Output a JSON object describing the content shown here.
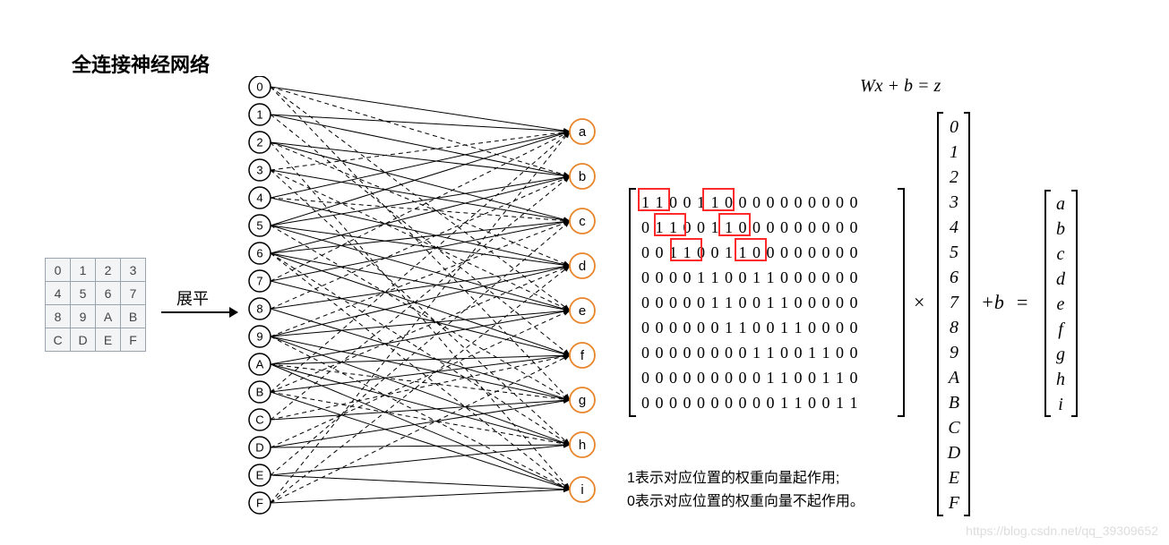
{
  "title": "全连接神经网络",
  "grid": [
    [
      "0",
      "1",
      "2",
      "3"
    ],
    [
      "4",
      "5",
      "6",
      "7"
    ],
    [
      "8",
      "9",
      "A",
      "B"
    ],
    [
      "C",
      "D",
      "E",
      "F"
    ]
  ],
  "flatten_label": "展平",
  "input_nodes": [
    "0",
    "1",
    "2",
    "3",
    "4",
    "5",
    "6",
    "7",
    "8",
    "9",
    "A",
    "B",
    "C",
    "D",
    "E",
    "F"
  ],
  "output_nodes": [
    "a",
    "b",
    "c",
    "d",
    "e",
    "f",
    "g",
    "h",
    "i"
  ],
  "equation": "Wx + b = z",
  "W_rows": [
    "1 1 0 0 1 1 0 0 0 0 0 0 0 0 0 0",
    "0 1 1 0 0 1 1 0 0 0 0 0 0 0 0 0",
    "0 0 1 1 0 0 1 1 0 0 0 0 0 0 0 0",
    "0 0 0 0 1 1 0 0 1 1 0 0 0 0 0 0",
    "0 0 0 0 0 1 1 0 0 1 1 0 0 0 0 0",
    "0 0 0 0 0 0 1 1 0 0 1 1 0 0 0 0",
    "0 0 0 0 0 0 0 0 1 1 0 0 1 1 0 0",
    "0 0 0 0 0 0 0 0 0 1 1 0 0 1 1 0",
    "0 0 0 0 0 0 0 0 0 0 1 1 0 0 1 1"
  ],
  "x_vec": [
    "0",
    "1",
    "2",
    "3",
    "4",
    "5",
    "6",
    "7",
    "8",
    "9",
    "A",
    "B",
    "C",
    "D",
    "E",
    "F"
  ],
  "z_vec": [
    "a",
    "b",
    "c",
    "d",
    "e",
    "f",
    "g",
    "h",
    "i"
  ],
  "times": "×",
  "plus_b": "+b",
  "equals": "=",
  "explain_line1": "1表示对应位置的权重向量起作用;",
  "explain_line2": "0表示对应位置的权重向量不起作用。",
  "watermark": "https://blog.csdn.net/qq_39309652",
  "edges_solid": [
    [
      0,
      0
    ],
    [
      1,
      0
    ],
    [
      4,
      0
    ],
    [
      5,
      0
    ],
    [
      1,
      1
    ],
    [
      2,
      1
    ],
    [
      5,
      1
    ],
    [
      6,
      1
    ],
    [
      2,
      2
    ],
    [
      3,
      2
    ],
    [
      6,
      2
    ],
    [
      7,
      2
    ],
    [
      4,
      3
    ],
    [
      5,
      3
    ],
    [
      8,
      3
    ],
    [
      9,
      3
    ],
    [
      5,
      4
    ],
    [
      6,
      4
    ],
    [
      9,
      4
    ],
    [
      10,
      4
    ],
    [
      6,
      5
    ],
    [
      7,
      5
    ],
    [
      10,
      5
    ],
    [
      11,
      5
    ],
    [
      8,
      6
    ],
    [
      9,
      6
    ],
    [
      12,
      6
    ],
    [
      13,
      6
    ],
    [
      9,
      7
    ],
    [
      10,
      7
    ],
    [
      13,
      7
    ],
    [
      14,
      7
    ],
    [
      10,
      8
    ],
    [
      11,
      8
    ],
    [
      14,
      8
    ],
    [
      15,
      8
    ]
  ],
  "edges_dash": [
    [
      3,
      0
    ],
    [
      7,
      0
    ],
    [
      11,
      0
    ],
    [
      15,
      0
    ],
    [
      0,
      1
    ],
    [
      8,
      1
    ],
    [
      12,
      1
    ],
    [
      4,
      2
    ],
    [
      9,
      2
    ],
    [
      14,
      2
    ],
    [
      2,
      3
    ],
    [
      11,
      3
    ],
    [
      15,
      3
    ],
    [
      0,
      4
    ],
    [
      3,
      4
    ],
    [
      13,
      4
    ],
    [
      1,
      5
    ],
    [
      12,
      5
    ],
    [
      15,
      5
    ],
    [
      0,
      6
    ],
    [
      5,
      6
    ],
    [
      10,
      6
    ],
    [
      3,
      7
    ],
    [
      6,
      7
    ],
    [
      11,
      7
    ],
    [
      2,
      8
    ],
    [
      6,
      8
    ],
    [
      9,
      8
    ]
  ],
  "red_boxes": [
    {
      "row": 0,
      "col_start": 0,
      "col_end": 1
    },
    {
      "row": 0,
      "col_start": 4,
      "col_end": 5
    },
    {
      "row": 1,
      "col_start": 1,
      "col_end": 2
    },
    {
      "row": 1,
      "col_start": 5,
      "col_end": 6
    },
    {
      "row": 2,
      "col_start": 2,
      "col_end": 3
    },
    {
      "row": 2,
      "col_start": 6,
      "col_end": 7
    }
  ]
}
